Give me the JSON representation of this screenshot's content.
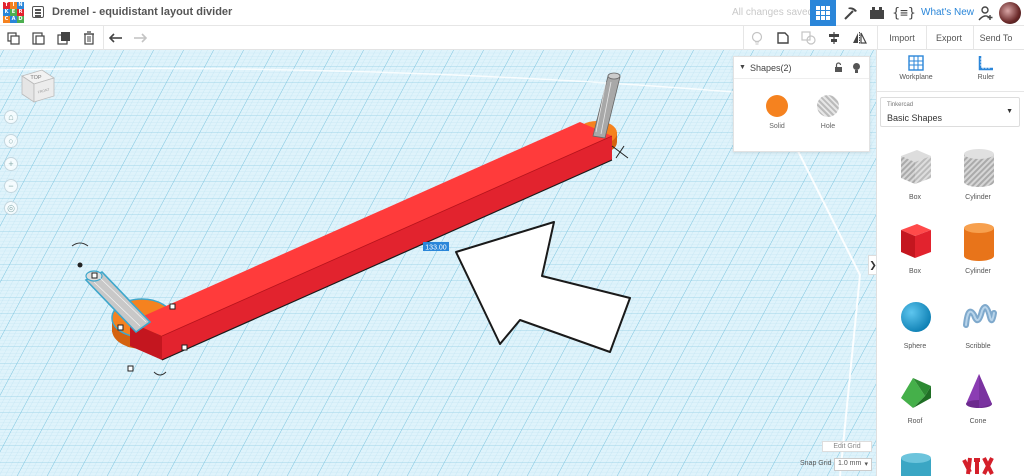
{
  "app": {
    "logo_letters": [
      "T",
      "I",
      "N",
      "K",
      "E",
      "R",
      "C",
      "A",
      "D"
    ],
    "title": "Dremel - equidistant layout divider",
    "save_status": "All changes saved",
    "whats_new": "What's New"
  },
  "toolbar": {
    "import_label": "Import",
    "export_label": "Export",
    "send_to_label": "Send To"
  },
  "viewcube": {
    "top_label": "TOP",
    "front_label": "FRONT"
  },
  "canvas": {
    "dimension_label": "133.00",
    "edit_grid_label": "Edit Grid",
    "snap_grid_label": "Snap Grid",
    "snap_grid_value": "1.0 mm"
  },
  "inspector": {
    "title": "Shapes(2)",
    "solid_label": "Solid",
    "hole_label": "Hole",
    "solid_color": "#f5821f"
  },
  "right_panel": {
    "workplane_label": "Workplane",
    "ruler_label": "Ruler",
    "library_caption": "Tinkercad",
    "library_value": "Basic Shapes",
    "shapes": [
      {
        "name": "Box",
        "kind": "box-hole"
      },
      {
        "name": "Cylinder",
        "kind": "cyl-hole"
      },
      {
        "name": "Box",
        "kind": "box"
      },
      {
        "name": "Cylinder",
        "kind": "cyl"
      },
      {
        "name": "Sphere",
        "kind": "sphere"
      },
      {
        "name": "Scribble",
        "kind": "scribble"
      },
      {
        "name": "Roof",
        "kind": "roof"
      },
      {
        "name": "Cone",
        "kind": "cone"
      }
    ]
  },
  "colors": {
    "accent": "#2a86d9",
    "red_box": "#e2232e",
    "orange": "#f5821f",
    "grid_bg": "#dff3fb"
  }
}
